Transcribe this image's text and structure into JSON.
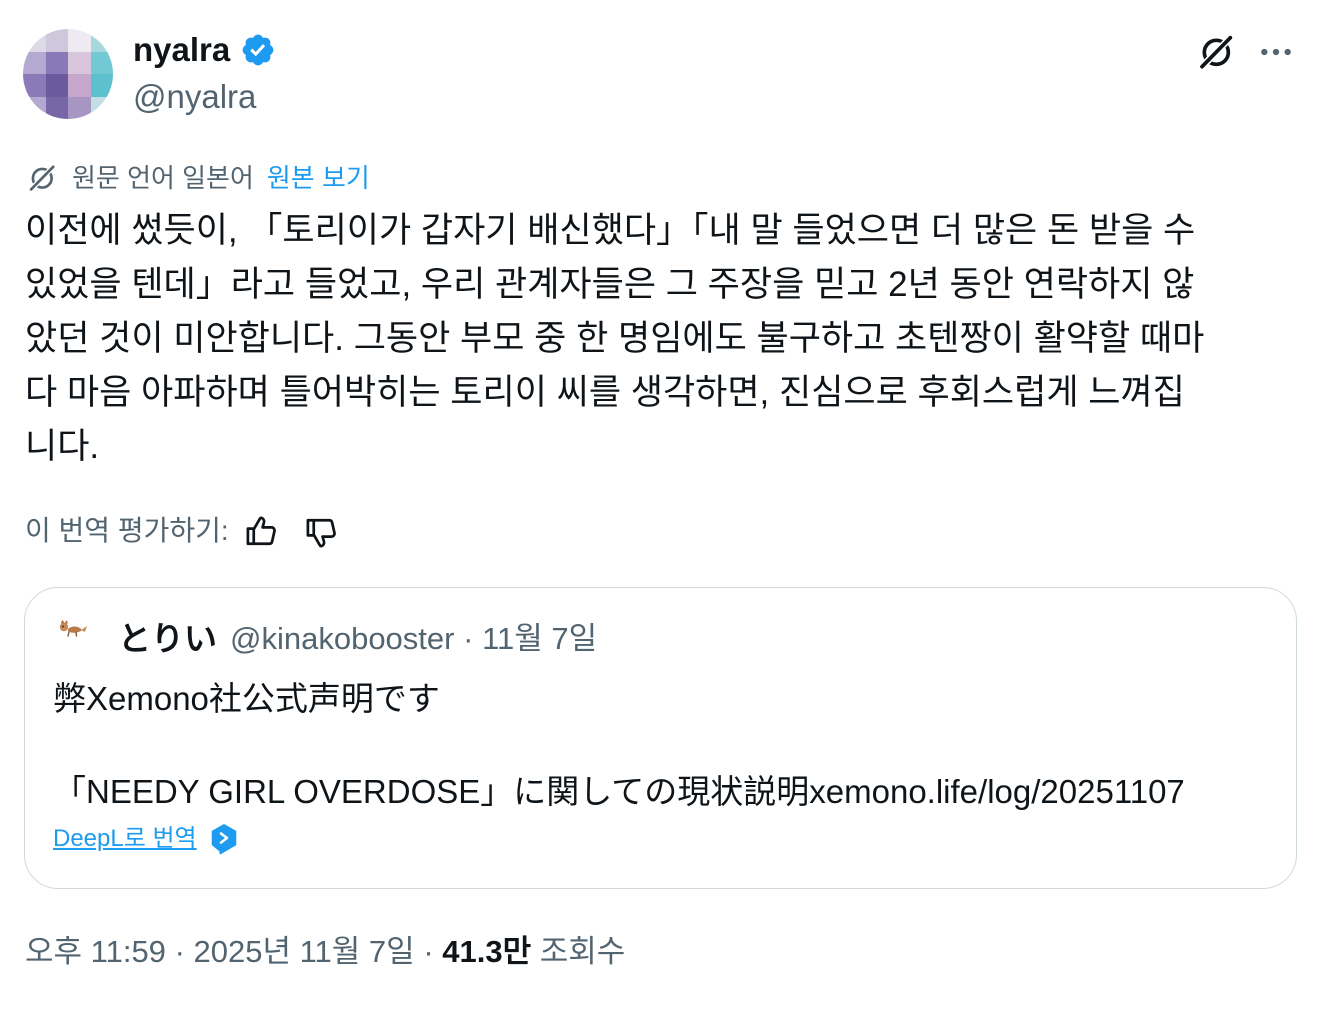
{
  "author": {
    "display_name": "nyalra",
    "handle": "@nyalra",
    "verified": true
  },
  "translation": {
    "source_language_text": "원문 언어 일본어",
    "show_original_label": "원본 보기"
  },
  "tweet": {
    "text_lines": [
      "이전에 썼듯이, 「토리이가 갑자기 배신했다」「내 말 들었으면 더 많은 돈 받을 수",
      "있었을 텐데」라고 들었고, 우리 관계자들은 그 주장을 믿고 2년 동안 연락하지 않",
      "았던 것이 미안합니다. 그동안 부모 중 한 명임에도 불구하고 초텐짱이 활약할 때마",
      "다 마음 아파하며 틀어박히는 토리이 씨를 생각하면, 진심으로 후회스럽게 느껴집",
      "니다."
    ]
  },
  "rate_translation": {
    "label": "이 번역 평가하기:"
  },
  "quote": {
    "author_name": "とりい",
    "handle": "@kinakobooster",
    "separator": "·",
    "date": "11월 7일",
    "paragraphs": [
      "弊Xemono社公式声明です",
      "「NEEDY GIRL OVERDOSE」に関しての現状説明xemono.life/log/20251107"
    ],
    "translate_label": "DeepL로 번역"
  },
  "footer": {
    "time": "오후 11:59",
    "separator": "·",
    "date": "2025년 11월 7일",
    "views_count": "41.3만",
    "views_label": "조회수"
  },
  "icons": {
    "verified": "verified-badge-icon",
    "grok": "grok-icon",
    "more": "more-icon",
    "translate": "translate-icon",
    "thumbs_up": "thumbs-up-icon",
    "thumbs_down": "thumbs-down-icon",
    "deepl": "deepl-icon"
  },
  "colors": {
    "text": "#0f1419",
    "secondary": "#536471",
    "accent": "#1d9bf0",
    "border": "#cfd9de"
  }
}
